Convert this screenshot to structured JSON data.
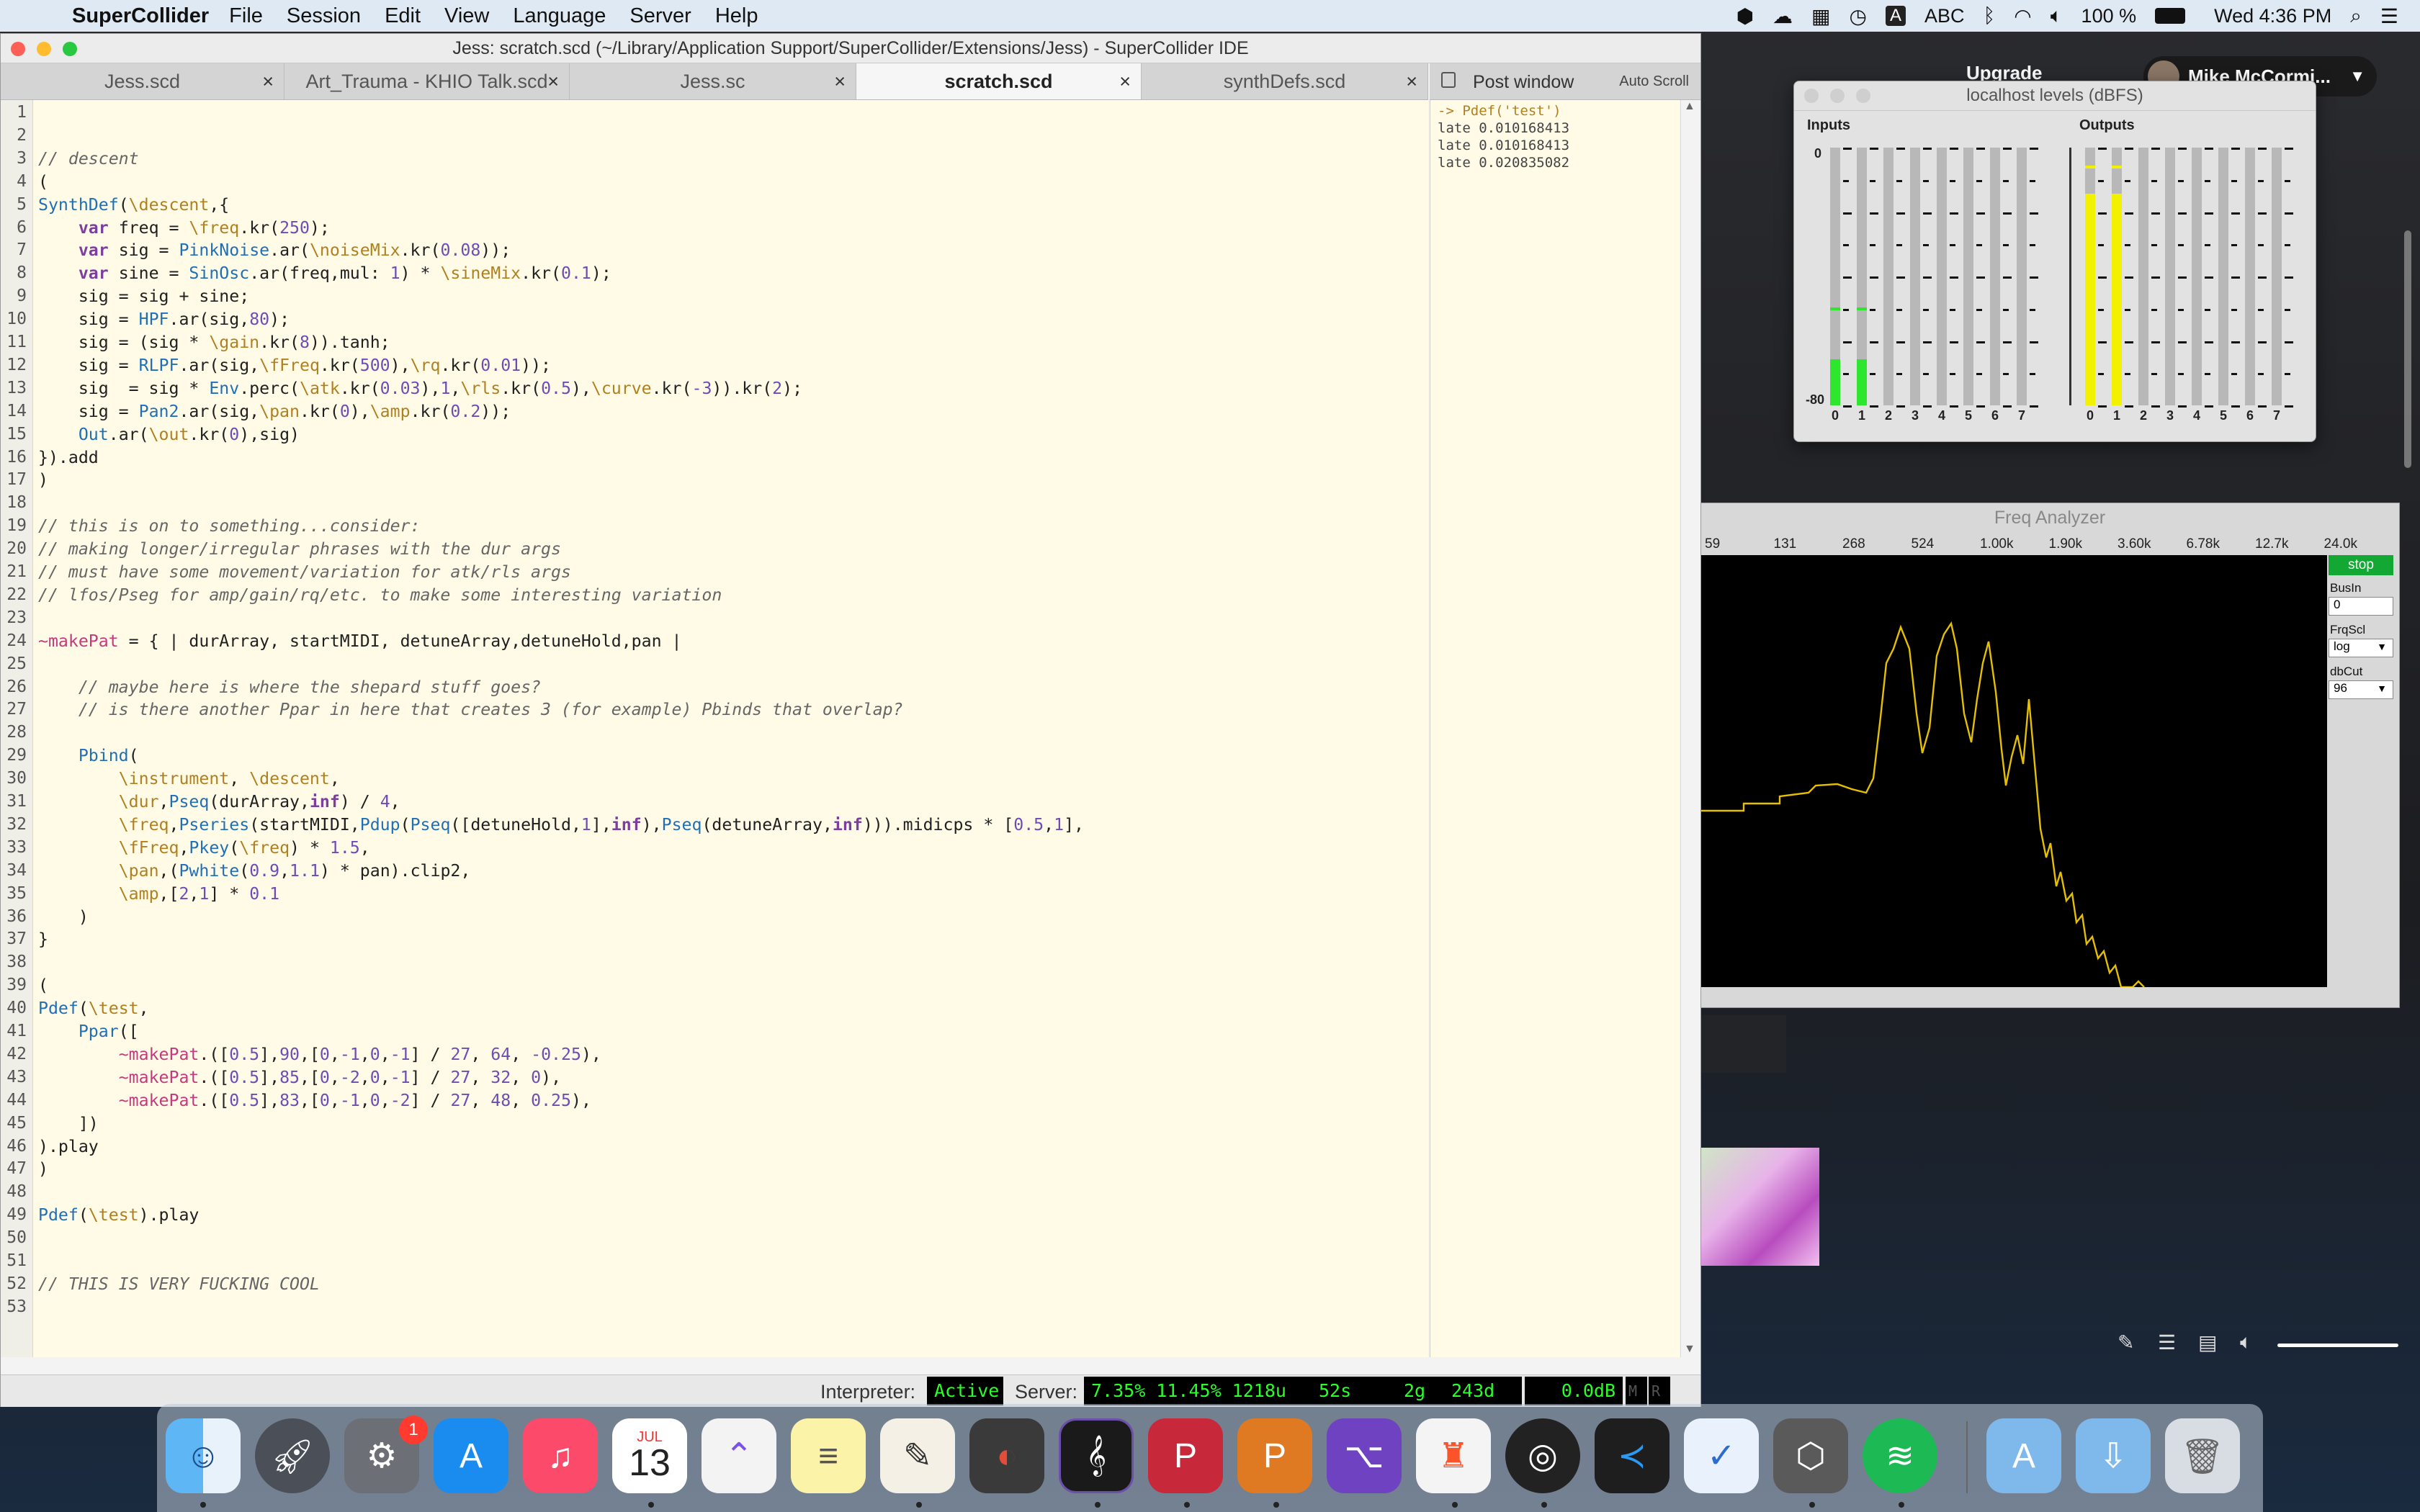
{
  "menubar": {
    "app_name": "SuperCollider",
    "items": [
      "File",
      "Session",
      "Edit",
      "View",
      "Language",
      "Server",
      "Help"
    ],
    "input_source": "ABC",
    "battery": "100 %",
    "clock": "Wed 4:36 PM"
  },
  "ide": {
    "title": "Jess: scratch.scd (~/Library/Application Support/SuperCollider/Extensions/Jess) - SuperCollider IDE",
    "tabs": [
      {
        "label": "Jess.scd",
        "active": false
      },
      {
        "label": "Art_Trauma - KHIO Talk.scd",
        "active": false
      },
      {
        "label": "Jess.sc",
        "active": false
      },
      {
        "label": "scratch.scd",
        "active": true
      },
      {
        "label": "synthDefs.scd",
        "active": false
      }
    ],
    "tab_close": "×",
    "post_window_title": "Post window",
    "auto_scroll": "Auto Scroll",
    "post_lines": [
      "-> Pdef('test')",
      "late 0.010168413",
      "late 0.010168413",
      "late 0.020835082"
    ],
    "code": [
      "",
      "",
      "// descent",
      "(",
      "SynthDef(\\descent,{",
      "    var freq = \\freq.kr(250);",
      "    var sig = PinkNoise.ar(\\noiseMix.kr(0.08));",
      "    var sine = SinOsc.ar(freq,mul: 1) * \\sineMix.kr(0.1);",
      "    sig = sig + sine;",
      "    sig = HPF.ar(sig,80);",
      "    sig = (sig * \\gain.kr(8)).tanh;",
      "    sig = RLPF.ar(sig,\\fFreq.kr(500),\\rq.kr(0.01));",
      "    sig  = sig * Env.perc(\\atk.kr(0.03),1,\\rls.kr(0.5),\\curve.kr(-3)).kr(2);",
      "    sig = Pan2.ar(sig,\\pan.kr(0),\\amp.kr(0.2));",
      "    Out.ar(\\out.kr(0),sig)",
      "}).add",
      ")",
      "",
      "// this is on to something...consider:",
      "// making longer/irregular phrases with the dur args",
      "// must have some movement/variation for atk/rls args",
      "// lfos/Pseg for amp/gain/rq/etc. to make some interesting variation",
      "",
      "~makePat = { | durArray, startMIDI, detuneArray,detuneHold,pan |",
      "",
      "    // maybe here is where the shepard stuff goes?",
      "    // is there another Ppar in here that creates 3 (for example) Pbinds that overlap?",
      "",
      "    Pbind(",
      "        \\instrument, \\descent,",
      "        \\dur,Pseq(durArray,inf) / 4,",
      "        \\freq,Pseries(startMIDI,Pdup(Pseq([detuneHold,1],inf),Pseq(detuneArray,inf))).midicps * [0.5,1],",
      "        \\fFreq,Pkey(\\freq) * 1.5,",
      "        \\pan,(Pwhite(0.9,1.1) * pan).clip2,",
      "        \\amp,[2,1] * 0.1",
      "    )",
      "}",
      "",
      "(",
      "Pdef(\\test,",
      "    Ppar([",
      "        ~makePat.([0.5],90,[0,-1,0,-1] / 27, 64, -0.25),",
      "        ~makePat.([0.5],85,[0,-2,0,-1] / 27, 32, 0),",
      "        ~makePat.([0.5],83,[0,-1,0,-2] / 27, 48, 0.25),",
      "    ])",
      ").play",
      ")",
      "",
      "Pdef(\\test).play",
      "",
      "",
      "// THIS IS VERY FUCKING COOL",
      ""
    ],
    "status": {
      "interpreter_label": "Interpreter:",
      "interpreter_value": "Active",
      "server_label": "Server:",
      "server_cpu": "7.35% 11.45% 1218u",
      "server_synths": "52s",
      "server_groups": "2g",
      "server_defs": "243d",
      "server_volume": "0.0dB",
      "m": "M",
      "r": "R"
    }
  },
  "levels": {
    "title": "localhost levels (dBFS)",
    "inputs_label": "Inputs",
    "outputs_label": "Outputs",
    "scale_top": "0",
    "scale_bottom": "-80",
    "channels": [
      "0",
      "1",
      "2",
      "3",
      "4",
      "5",
      "6",
      "7"
    ],
    "input_levels": [
      0.18,
      0.18,
      0,
      0,
      0,
      0,
      0,
      0
    ],
    "output_levels": [
      0.82,
      0.82,
      0,
      0,
      0,
      0,
      0,
      0
    ]
  },
  "freq_analyzer": {
    "title": "Freq Analyzer",
    "freq_labels": [
      "59",
      "131",
      "268",
      "524",
      "1.00k",
      "1.90k",
      "3.60k",
      "6.78k",
      "12.7k",
      "24.0k"
    ],
    "stop_button": "stop",
    "bus_in_label": "BusIn",
    "bus_in_value": "0",
    "frq_scl_label": "FrqScl",
    "frq_scl_value": "log",
    "db_cut_label": "dbCut",
    "db_cut_value": "96"
  },
  "zoom": {
    "upgrade": "Upgrade",
    "user_name": "Mike McCormi..."
  },
  "dock": {
    "calendar_month": "JUL",
    "calendar_day": "13",
    "settings_badge": "1"
  },
  "colors": {
    "editor_bg": "#fffbe7",
    "status_green": "#2aff2a",
    "meter_green": "#2ee62e",
    "meter_yellow": "#f2f200",
    "spectrum": "#e5c000"
  }
}
